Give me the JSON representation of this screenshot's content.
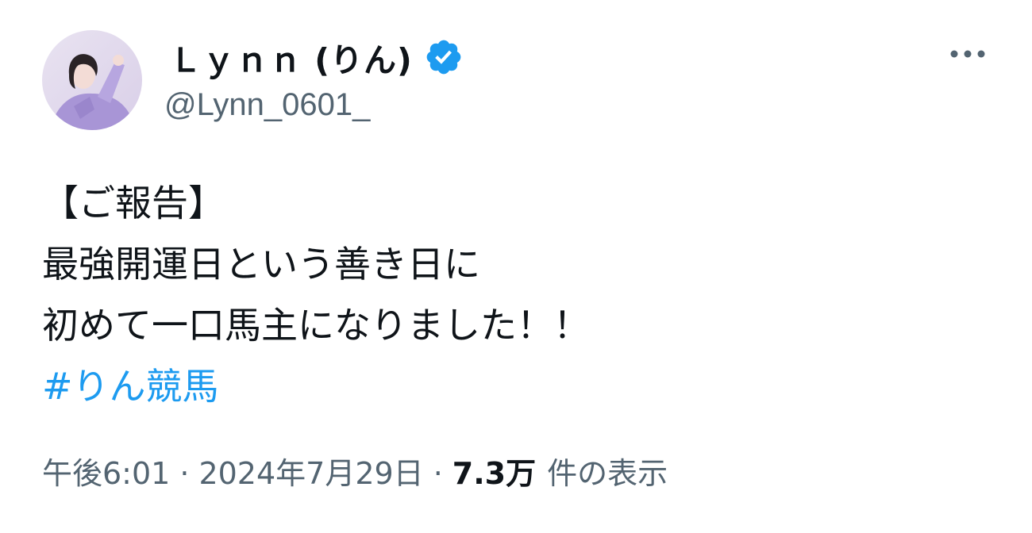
{
  "author": {
    "display_name": "Ｌｙｎｎ (りん)",
    "handle": "@Lynn_0601_",
    "verified": true,
    "avatar_icon": "profile-photo",
    "verified_icon": "verified-badge-icon"
  },
  "menu": {
    "more_icon": "more-options-icon"
  },
  "post": {
    "lines": [
      "【ご報告】",
      "最強開運日という善き日に",
      "初めて一口馬主になりました！！"
    ],
    "hashtag": "#りん競馬"
  },
  "meta": {
    "time": "午後6:01",
    "separator": "·",
    "date": "2024年7月29日",
    "views_count": "7.3万",
    "views_label": "件の表示"
  },
  "colors": {
    "text": "#0f1419",
    "secondary": "#536471",
    "link": "#1d9bf0",
    "verified": "#1d9bf0"
  }
}
